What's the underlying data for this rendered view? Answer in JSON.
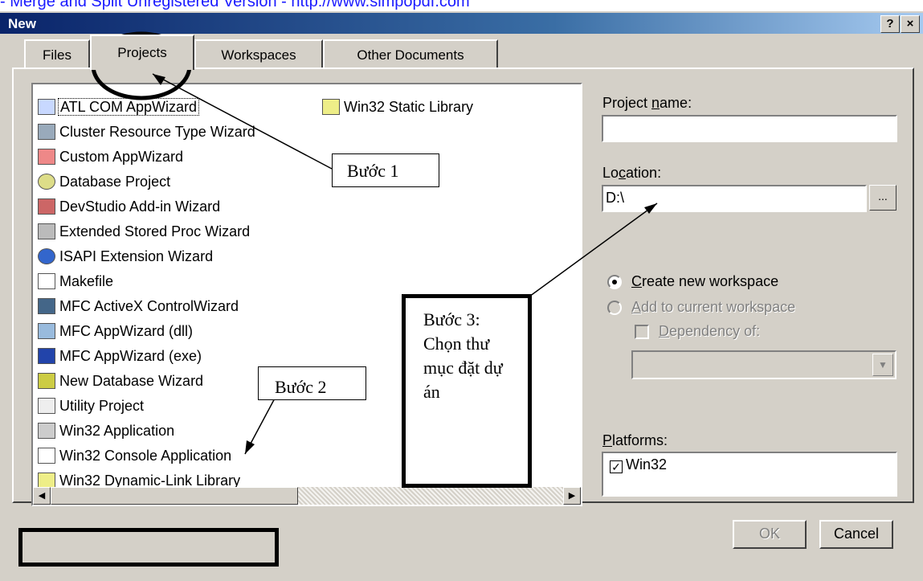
{
  "watermark": "- Merge and Split Unregistered Version - http://www.simpopdf.com",
  "window": {
    "title": "New",
    "help_button": "?",
    "close_button": "×"
  },
  "tabs": [
    "Files",
    "Projects",
    "Workspaces",
    "Other Documents"
  ],
  "project_types": [
    "ATL COM AppWizard",
    "Cluster Resource Type Wizard",
    "Custom AppWizard",
    "Database Project",
    "DevStudio Add-in Wizard",
    "Extended Stored Proc Wizard",
    "ISAPI Extension Wizard",
    "Makefile",
    "MFC ActiveX ControlWizard",
    "MFC AppWizard (dll)",
    "MFC AppWizard (exe)",
    "New Database Wizard",
    "Utility Project",
    "Win32 Application",
    "Win32 Console Application",
    "Win32 Dynamic-Link Library",
    "Win32 Static Library"
  ],
  "selected_project": "ATL COM AppWizard",
  "project_name": {
    "label_pre": "Project ",
    "label_ul": "n",
    "label_post": "ame:",
    "value": ""
  },
  "location": {
    "label_pre": "Lo",
    "label_ul": "c",
    "label_post": "ation:",
    "value": "D:\\",
    "browse": "..."
  },
  "workspace": {
    "create_ul": "C",
    "create_rest": "reate new workspace",
    "add_ul": "A",
    "add_rest": "dd to current workspace",
    "dep_ul": "D",
    "dep_rest": "ependency of:"
  },
  "platforms": {
    "label_ul": "P",
    "label_rest": "latforms:",
    "items": [
      "Win32"
    ],
    "checked": true
  },
  "buttons": {
    "ok": "OK",
    "cancel": "Cancel"
  },
  "annotations": {
    "step1": "Bước 1",
    "step2": "Bước 2",
    "step3": "Bước 3: Chọn thư mục đặt dự án"
  },
  "colors": {
    "annotation_line": "#000000",
    "watermark": "#1a1aff",
    "title_bar": "#0a246a"
  }
}
